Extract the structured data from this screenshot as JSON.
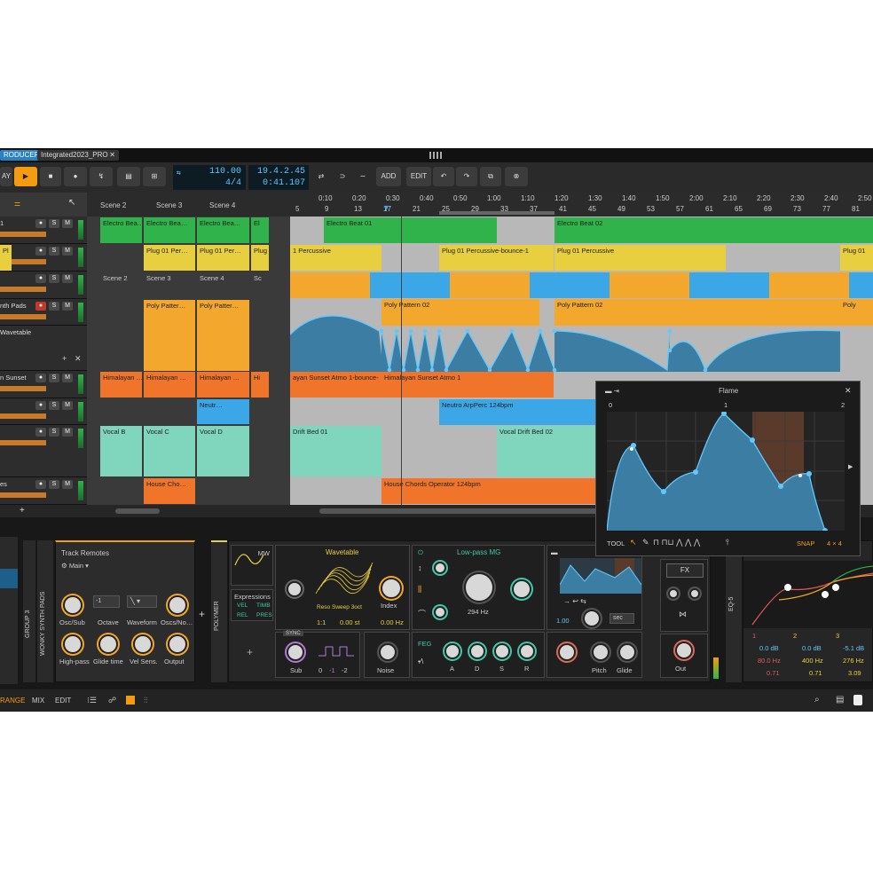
{
  "titlebar": {
    "product_tab": "RODUCER",
    "project_tab": "Integrated2023_PRO",
    "close_glyph": "✕"
  },
  "transport": {
    "play_label": "AY",
    "tempo": "110.00",
    "signature": "4/4",
    "position_bars": "19.4.2.45",
    "position_time": "0:41.107",
    "add_label": "ADD",
    "edit_label": "EDIT"
  },
  "launcher": {
    "scenes": [
      "Scene 2",
      "Scene 3",
      "Scene 4"
    ],
    "menu_glyph": "="
  },
  "ruler": {
    "time_labels": [
      "0:10",
      "0:20",
      "0:30",
      "0:40",
      "0:50",
      "1:00",
      "1:10",
      "1:20",
      "1:30",
      "1:40",
      "1:50",
      "2:00",
      "2:10",
      "2:20",
      "2:30",
      "2:40",
      "2:50"
    ],
    "bar_labels": [
      "5",
      "9",
      "13",
      "17",
      "21",
      "25",
      "29",
      "33",
      "37",
      "41",
      "45",
      "49",
      "53",
      "57",
      "61",
      "65",
      "69",
      "73",
      "77",
      "81"
    ]
  },
  "tracks": [
    {
      "name": "1",
      "s": "S",
      "m": "M"
    },
    {
      "name": "",
      "s": "S",
      "m": "M"
    },
    {
      "name": "",
      "s": "S",
      "m": "M"
    },
    {
      "name": "nth Pads",
      "s": "S",
      "m": "M"
    },
    {
      "name": "Wavetable"
    },
    {
      "name": "n Sunset",
      "s": "S",
      "m": "M"
    },
    {
      "name": "",
      "s": "S",
      "m": "M"
    },
    {
      "name": "",
      "s": "S",
      "m": "M"
    },
    {
      "name": "es",
      "s": "S",
      "m": "M"
    }
  ],
  "slots": {
    "r0": [
      "Electro Bea…",
      "Electro Bea…",
      "Electro Bea…",
      "El"
    ],
    "r1": [
      "Plug 01 Per…",
      "Plug 01 Per…",
      "Plug 01 Per…",
      "Pl"
    ],
    "r2": [
      "Scene 2",
      "Scene 3",
      "Scene 4",
      "Sc"
    ],
    "r3": [
      "Poly Patter…",
      "Poly Patter…"
    ],
    "r5": [
      "Himalayan …",
      "Himalayan …",
      "Himalayan …",
      "Hi"
    ],
    "r6": [
      "Neutr…"
    ],
    "r7": [
      "Vocal B",
      "Vocal C",
      "Vocal D"
    ],
    "r8": [
      "House Cho…"
    ]
  },
  "clips": {
    "electro1": "Electro Beat 01",
    "electro2": "Electro Beat 02",
    "perc1": "1 Percussive",
    "perc_bounce": "Plug 01 Percussive-bounce-1",
    "perc2": "Plug 01 Percussive",
    "perc3": "Plug 01",
    "poly1": "Poly Pattern 02",
    "poly2": "Poly Pattern 02",
    "poly3": "Poly",
    "himal1": "ayan Sunset Atmo 1-bounce-",
    "himal2": "Himalayan Sunset Atmo 1",
    "neutro": "Neutro ArpPerc 124bpm",
    "drift1": "Drift Bed 01",
    "drift2": "Vocal Drift Bed 02",
    "house": "House Chords Operator 124bpm"
  },
  "flame": {
    "title": "Flame",
    "ruler": [
      "0",
      "1",
      "2"
    ],
    "tool_label": "TOOL",
    "snap_label": "SNAP",
    "grid": "4 × 4"
  },
  "remotes": {
    "title": "Track Remotes",
    "page": "Main",
    "dropdown1": "-1",
    "knobs_top": [
      "Osc/Sub",
      "Octave",
      "Waveform",
      "Oscs/No…"
    ],
    "knobs_bottom": [
      "High-pass",
      "Glide time",
      "Vel Sens.",
      "Output"
    ]
  },
  "vertical_labels": {
    "group": "GROUP 3",
    "wonky": "WONKY SYNTH PADS",
    "polymer": "POLYMER",
    "eq": "EQ-5"
  },
  "polymer": {
    "osc_mode": "MW",
    "wavetable": "Wavetable",
    "preset": "Reso Sweep 3oct",
    "index_label": "Index",
    "ratio": "1:1",
    "st": "0.00 st",
    "hz": "0.00 Hz",
    "expressions": "Expressions",
    "vel": "VEL",
    "timb": "TIMB",
    "rel": "REL",
    "pres": "PRES",
    "sync": "SYNC",
    "sub_label": "Sub",
    "sub_values": [
      "0",
      "-1",
      "-2"
    ],
    "noise_label": "Noise",
    "filter_name": "Low-pass MG",
    "cutoff": "294 Hz",
    "feg": "FEG",
    "adsr": [
      "A",
      "D",
      "S",
      "R"
    ],
    "sec": "sec",
    "glide_val": "1.00",
    "pitch_label": "Pitch",
    "glide_label": "Glide",
    "out_label": "Out",
    "fx_label": "FX",
    "add_glyph": "+"
  },
  "eq": {
    "bands": [
      "1",
      "2",
      "3"
    ],
    "gains": [
      "0.0 dB",
      "0.0 dB",
      "-5.1 dB"
    ],
    "freqs": [
      "80.0 Hz",
      "400 Hz",
      "276 Hz"
    ],
    "qs": [
      "0.71",
      "0.71",
      "3.09"
    ]
  },
  "statusbar": {
    "arrange": "RANGE",
    "mix": "MIX",
    "edit": "EDIT"
  },
  "colors": {
    "green": "#2fb34a",
    "yellow": "#e8cf3f",
    "orange": "#f0742a",
    "amber": "#f3a72c",
    "blue": "#3ba7e6",
    "teal": "#7fd6bd",
    "accent": "#f39c12"
  }
}
